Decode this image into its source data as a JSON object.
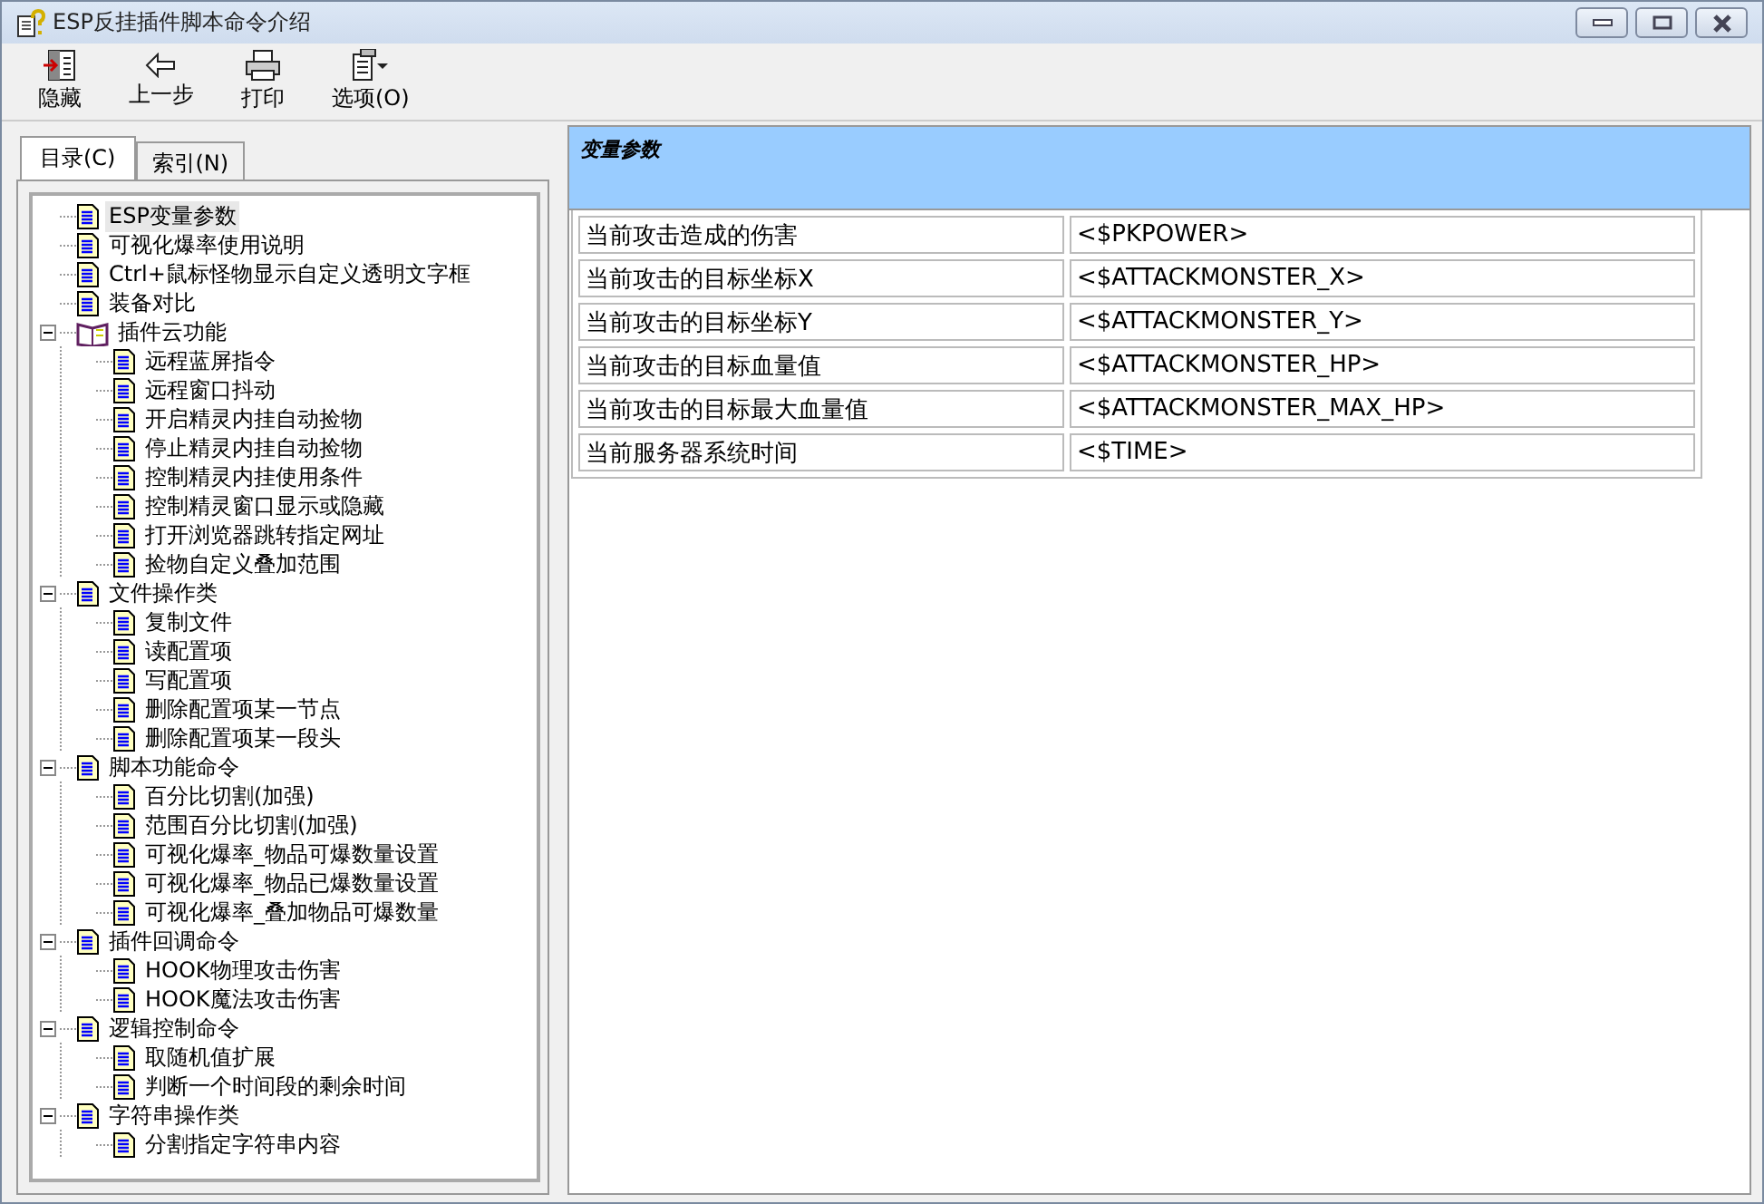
{
  "window": {
    "title": "ESP反挂插件脚本命令介绍"
  },
  "toolbar": [
    {
      "kind": "hide",
      "label": "隐藏"
    },
    {
      "kind": "back",
      "label": "上一步"
    },
    {
      "kind": "print",
      "label": "打印"
    },
    {
      "kind": "options",
      "label": "选项(O)"
    }
  ],
  "tabs": [
    {
      "label": "目录(C)",
      "selected": true
    },
    {
      "label": "索引(N)",
      "selected": false
    }
  ],
  "tree": [
    {
      "label": "ESP变量参数",
      "kind": "page",
      "selected": true
    },
    {
      "label": "可视化爆率使用说明",
      "kind": "page",
      "selected": false
    },
    {
      "label": "Ctrl+鼠标怪物显示自定义透明文字框",
      "kind": "page",
      "selected": false
    },
    {
      "label": "装备对比",
      "kind": "page",
      "selected": false
    },
    {
      "label": "插件云功能",
      "kind": "book",
      "selected": false,
      "expanded": true,
      "children": [
        {
          "label": "远程蓝屏指令",
          "kind": "page",
          "selected": false
        },
        {
          "label": "远程窗口抖动",
          "kind": "page",
          "selected": false
        },
        {
          "label": "开启精灵内挂自动捡物",
          "kind": "page",
          "selected": false
        },
        {
          "label": "停止精灵内挂自动捡物",
          "kind": "page",
          "selected": false
        },
        {
          "label": "控制精灵内挂使用条件",
          "kind": "page",
          "selected": false
        },
        {
          "label": "控制精灵窗口显示或隐藏",
          "kind": "page",
          "selected": false
        },
        {
          "label": "打开浏览器跳转指定网址",
          "kind": "page",
          "selected": false
        },
        {
          "label": "捡物自定义叠加范围",
          "kind": "page",
          "selected": false
        }
      ]
    },
    {
      "label": "文件操作类",
      "kind": "page",
      "selected": false,
      "expanded": true,
      "children": [
        {
          "label": "复制文件",
          "kind": "page",
          "selected": false
        },
        {
          "label": "读配置项",
          "kind": "page",
          "selected": false
        },
        {
          "label": "写配置项",
          "kind": "page",
          "selected": false
        },
        {
          "label": "删除配置项某一节点",
          "kind": "page",
          "selected": false
        },
        {
          "label": "删除配置项某一段头",
          "kind": "page",
          "selected": false
        }
      ]
    },
    {
      "label": "脚本功能命令",
      "kind": "page",
      "selected": false,
      "expanded": true,
      "children": [
        {
          "label": "百分比切割(加强)",
          "kind": "page",
          "selected": false
        },
        {
          "label": "范围百分比切割(加强)",
          "kind": "page",
          "selected": false
        },
        {
          "label": "可视化爆率_物品可爆数量设置",
          "kind": "page",
          "selected": false
        },
        {
          "label": "可视化爆率_物品已爆数量设置",
          "kind": "page",
          "selected": false
        },
        {
          "label": "可视化爆率_叠加物品可爆数量",
          "kind": "page",
          "selected": false
        }
      ]
    },
    {
      "label": "插件回调命令",
      "kind": "page",
      "selected": false,
      "expanded": true,
      "children": [
        {
          "label": "HOOK物理攻击伤害",
          "kind": "page",
          "selected": false
        },
        {
          "label": "HOOK魔法攻击伤害",
          "kind": "page",
          "selected": false
        }
      ]
    },
    {
      "label": "逻辑控制命令",
      "kind": "page",
      "selected": false,
      "expanded": true,
      "children": [
        {
          "label": "取随机值扩展",
          "kind": "page",
          "selected": false
        },
        {
          "label": "判断一个时间段的剩余时间",
          "kind": "page",
          "selected": false
        }
      ]
    },
    {
      "label": "字符串操作类",
      "kind": "page",
      "selected": false,
      "expanded": true,
      "children": [
        {
          "label": "分割指定字符串内容",
          "kind": "page",
          "selected": false
        }
      ]
    }
  ],
  "content": {
    "heading": "变量参数",
    "rows": [
      [
        "当前攻击造成的伤害",
        "<$PKPOWER>"
      ],
      [
        "当前攻击的目标坐标X",
        "<$ATTACKMONSTER_X>"
      ],
      [
        "当前攻击的目标坐标Y",
        "<$ATTACKMONSTER_Y>"
      ],
      [
        "当前攻击的目标血量值",
        "<$ATTACKMONSTER_HP>"
      ],
      [
        "当前攻击的目标最大血量值",
        "<$ATTACKMONSTER_MAX_HP>"
      ],
      [
        "当前服务器系统时间",
        "<$TIME>"
      ]
    ]
  }
}
